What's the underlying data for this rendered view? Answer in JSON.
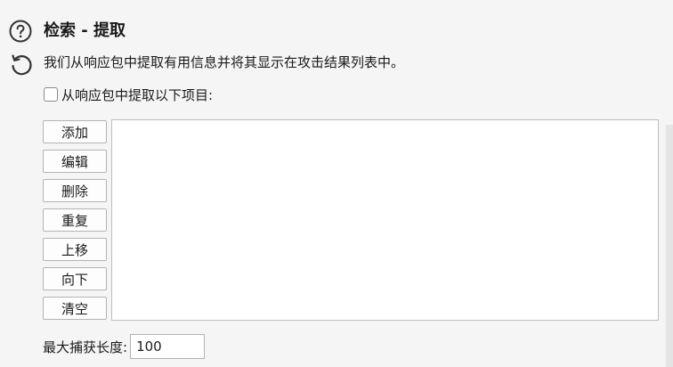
{
  "section": {
    "title": "检索 - 提取",
    "description": "我们从响应包中提取有用信息并将其显示在攻击结果列表中。",
    "help_icon": "help-circle-icon",
    "reset_icon": "undo-arrow-icon"
  },
  "extract": {
    "checkbox_label": "从响应包中提取以下项目:",
    "checked": false,
    "buttons": {
      "add": "添加",
      "edit": "编辑",
      "remove": "删除",
      "duplicate": "重复",
      "up": "上移",
      "down": "向下",
      "clear": "清空"
    },
    "items": []
  },
  "max_capture": {
    "label": "最大捕获长度:",
    "value": "100"
  }
}
